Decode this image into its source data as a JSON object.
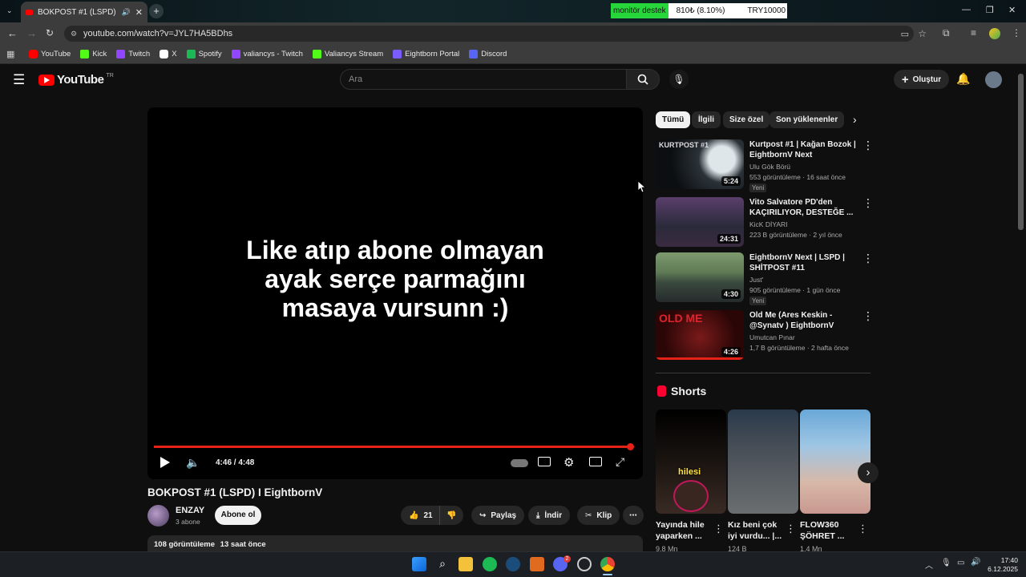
{
  "browser": {
    "tab_title": "BOKPOST #1 (LSPD) I Eigh",
    "url": "youtube.com/watch?v=JYL7HA5BDhs",
    "ticker": {
      "left": "monitör destek",
      "mid": "810₺ (8.10%)",
      "right": "TRY10000"
    },
    "bookmarks": [
      {
        "label": "YouTube",
        "color": "#ff0000"
      },
      {
        "label": "Kick",
        "color": "#53fc18"
      },
      {
        "label": "Twitch",
        "color": "#9146ff"
      },
      {
        "label": "X",
        "color": "#ffffff"
      },
      {
        "label": "Spotify",
        "color": "#1db954"
      },
      {
        "label": "valiancys - Twitch",
        "color": "#9146ff"
      },
      {
        "label": "Valiancys Stream",
        "color": "#53fc18"
      },
      {
        "label": "Eightborn Portal",
        "color": "#7b5cff"
      },
      {
        "label": "Discord",
        "color": "#5865f2"
      }
    ]
  },
  "yt": {
    "logo_text": "YouTube",
    "country": "TR",
    "search_placeholder": "Ara",
    "create_label": "Oluştur"
  },
  "player": {
    "overlay_text": "Like atıp abone olmayan ayak serçe parmağını masaya vursunn :)",
    "time": "4:46 / 4:48",
    "progress": 0.993
  },
  "video": {
    "title": "BOKPOST #1 (LSPD) I EightbornV",
    "channel": "ENZAY",
    "subs": "3 abone",
    "subscribe": "Abone ol",
    "likes": "21",
    "share": "Paylaş",
    "download": "İndir",
    "clip": "Klip",
    "views": "108 görüntüleme",
    "age": "13 saat önce"
  },
  "chips": [
    "Tümü",
    "İlgili",
    "Size özel",
    "Son yüklenenler"
  ],
  "recommendations": [
    {
      "title": "Kurtpost #1 | Kağan Bozok | EightbornV Next",
      "channel": "Ulu Gök Börü",
      "meta": "553 görüntüleme · 16 saat önce",
      "badge": "Yeni",
      "duration": "5:24",
      "thumb_text": "KURTPOST #1"
    },
    {
      "title": "Vito Salvatore PD'den KAÇIRILIYOR, DESTEĞE ...",
      "channel": "KicK DİYARI",
      "meta": "223 B görüntüleme · 2 yıl önce",
      "badge": "",
      "duration": "24:31",
      "thumb_text": ""
    },
    {
      "title": "EightbornV Next | LSPD | SHİTPOST #11",
      "channel": "Just'",
      "meta": "905 görüntüleme · 1 gün önce",
      "badge": "Yeni",
      "duration": "4:30",
      "thumb_text": ""
    },
    {
      "title": "Old Me (Ares Keskin - @Synatv ) EightbornV",
      "channel": "Umutcan Pınar",
      "meta": "1,7 B görüntüleme · 2 hafta önce",
      "badge": "",
      "duration": "4:26",
      "thumb_text": "OLD ME"
    }
  ],
  "shorts": {
    "heading": "Shorts",
    "items": [
      {
        "title": "Yayında hile yaparken ...",
        "views": "9,8 Mn",
        "thumb_text": "hilesi"
      },
      {
        "title": "Kız beni çok iyi vurdu... |...",
        "views": "124 B",
        "thumb_text": ""
      },
      {
        "title": "FLOW360 ŞÖHRET ...",
        "views": "1,4 Mn",
        "thumb_text": ""
      }
    ]
  },
  "taskbar": {
    "time": "17:40",
    "date": "6.12.2025",
    "discord_badge": "2"
  }
}
